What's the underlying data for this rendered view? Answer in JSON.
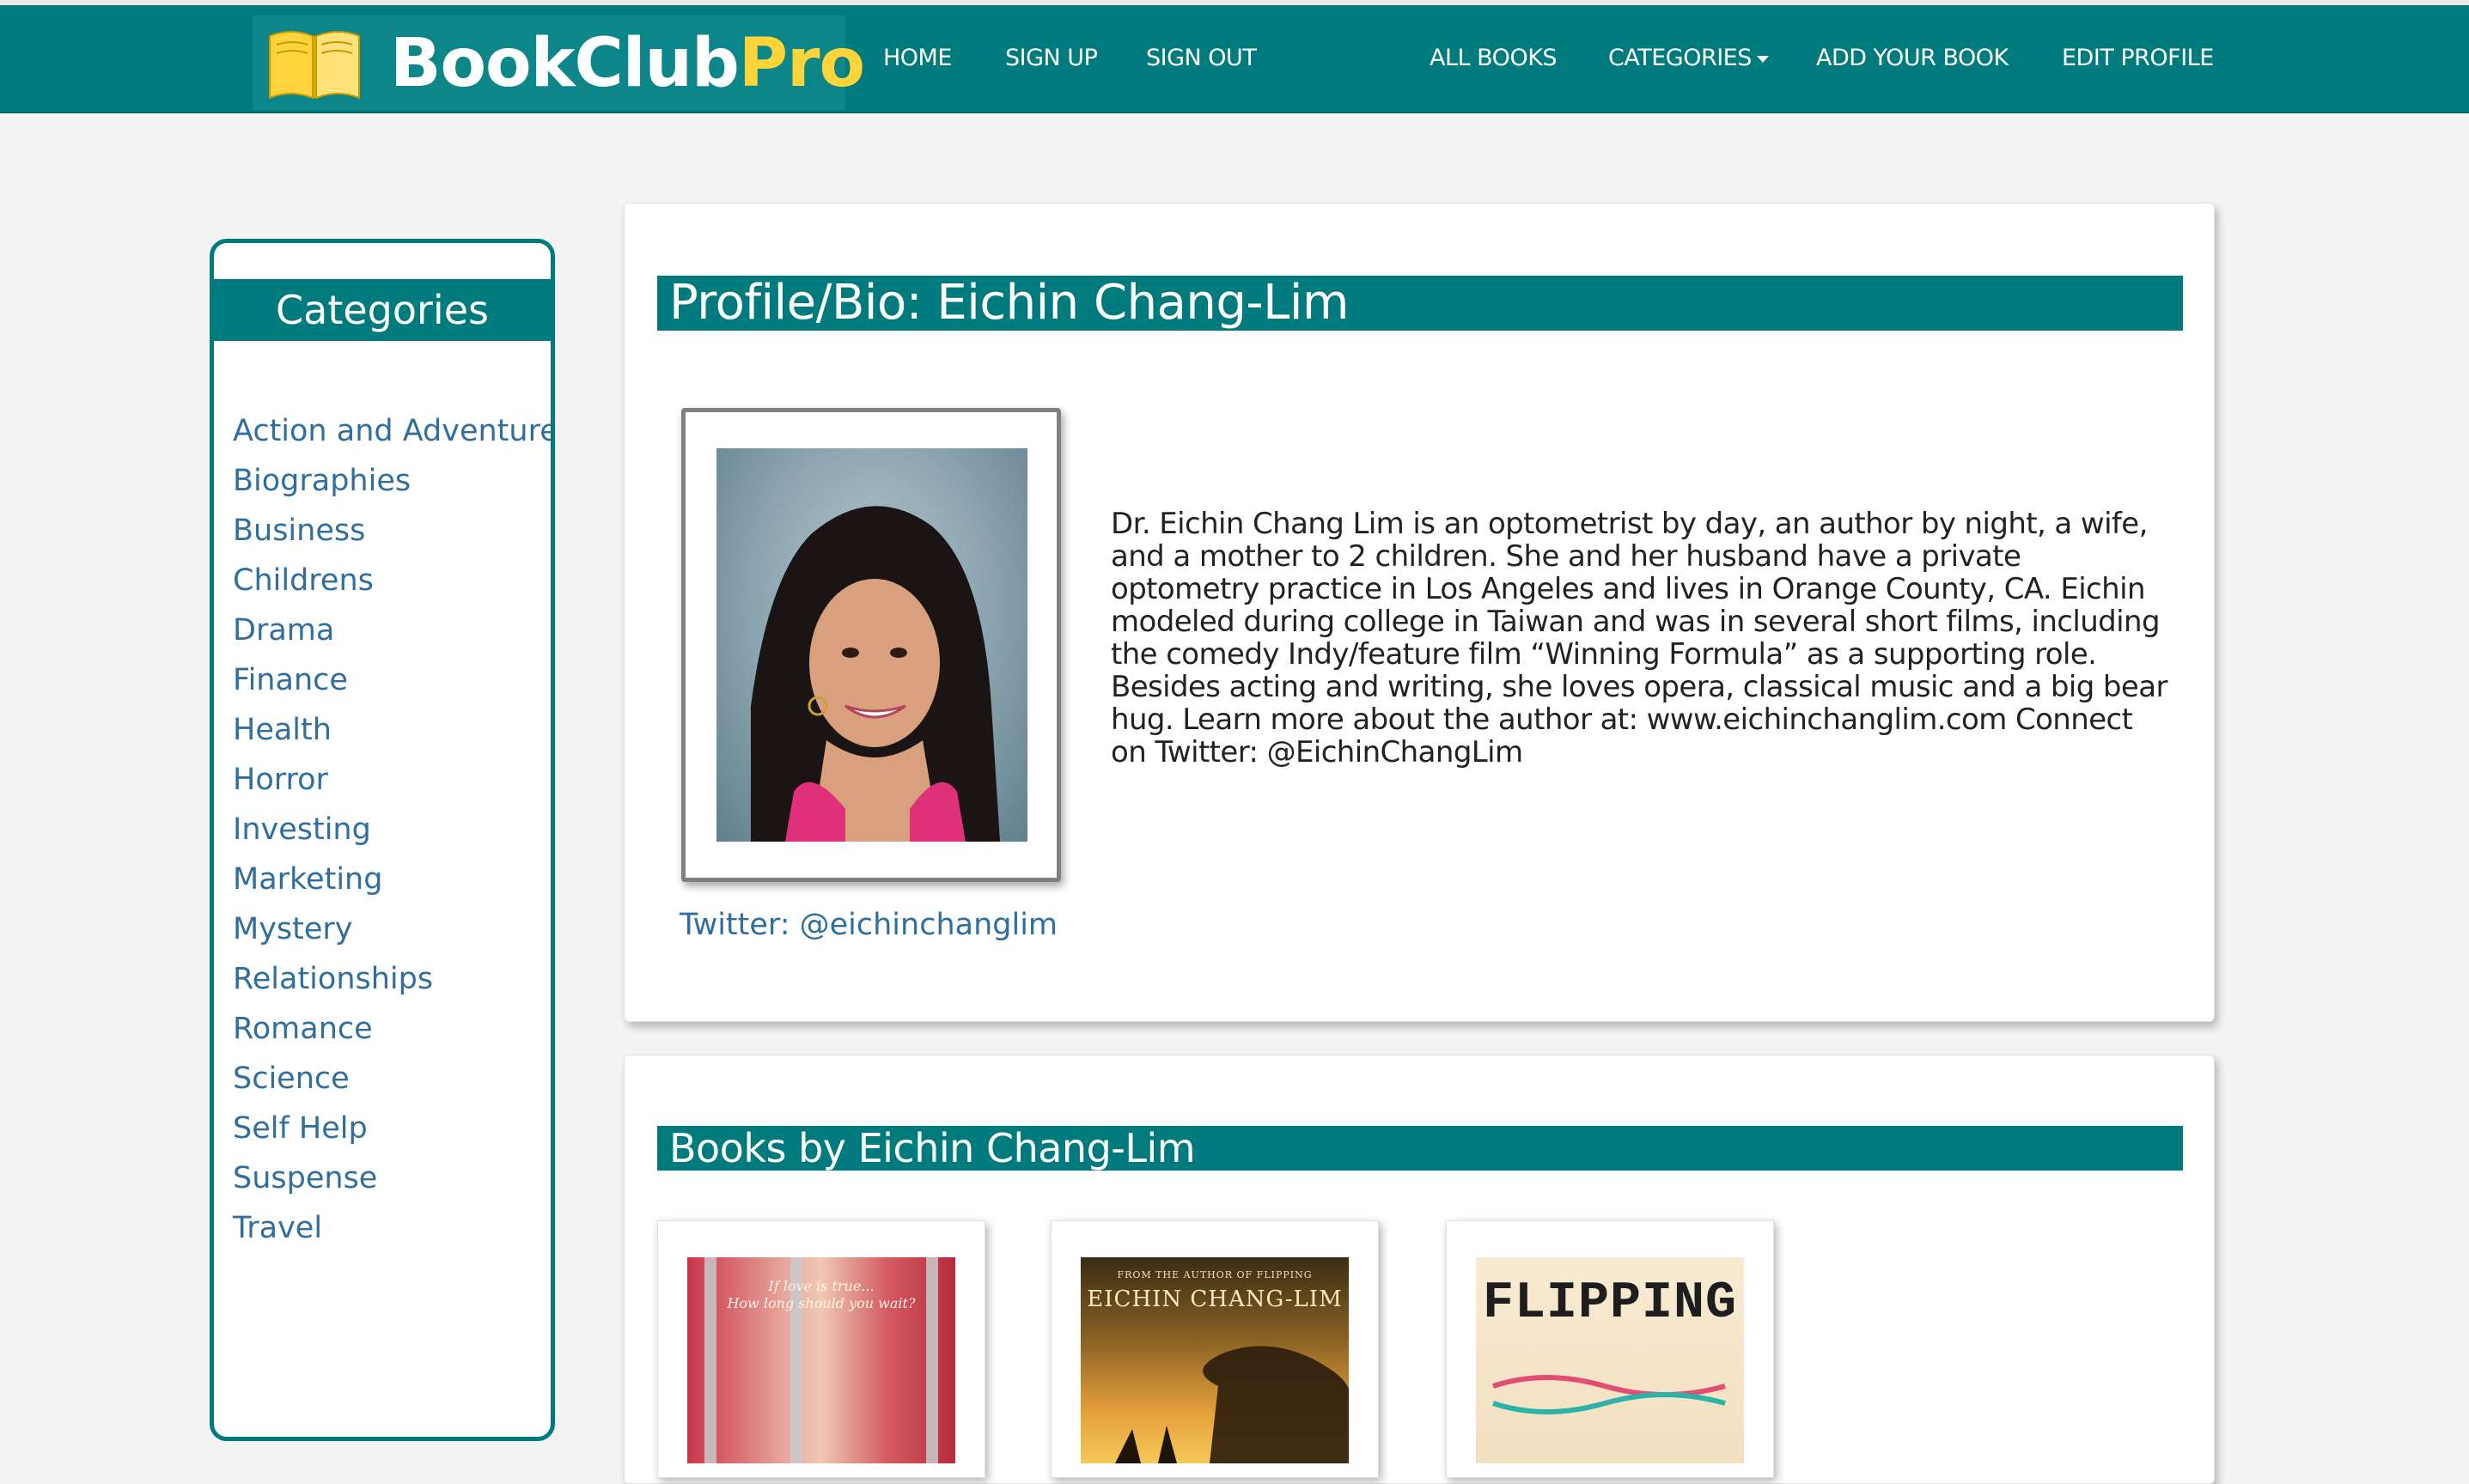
{
  "brand": {
    "name_part1": "BookClub",
    "name_part2": "Pro",
    "colors": {
      "accent": "#ffd43a",
      "bar": "#007b7d"
    }
  },
  "nav": {
    "home": "HOME",
    "sign_up": "SIGN UP",
    "sign_out": "SIGN OUT",
    "all_books": "ALL BOOKS",
    "categories": "CATEGORIES",
    "add_book": "ADD YOUR BOOK",
    "edit_profile": "EDIT PROFILE"
  },
  "sidebar": {
    "title": "Categories",
    "items": [
      "Action and Adventure",
      "Biographies",
      "Business",
      "Childrens",
      "Drama",
      "Finance",
      "Health",
      "Horror",
      "Investing",
      "Marketing",
      "Mystery",
      "Relationships",
      "Romance",
      "Science",
      "Self Help",
      "Suspense",
      "Travel"
    ]
  },
  "profile": {
    "heading": "Profile/Bio: Eichin Chang-Lim",
    "twitter": "Twitter: @eichinchanglim",
    "bio": "Dr. Eichin Chang Lim is an optometrist by day, an author by night, a wife, and a mother to 2 children. She and her husband have a private optometry practice in Los Angeles and lives in Orange County, CA. Eichin modeled during college in Taiwan and was in several short films, including the comedy Indy/feature film “Winning Formula” as a supporting role. Besides acting and writing, she loves opera, classical music and a big bear hug. Learn more about the author at: www.eichinchanglim.com Connect on Twitter: @EichinChangLim"
  },
  "books_section": {
    "heading": "Books by Eichin Chang-Lim",
    "covers": [
      {
        "line1": "If love is true...",
        "line2": "How long should you wait?"
      },
      {
        "line1": "FROM THE AUTHOR OF FLIPPING",
        "line2": "EICHIN CHANG-LIM"
      },
      {
        "line1": "FLIPPING"
      }
    ]
  }
}
